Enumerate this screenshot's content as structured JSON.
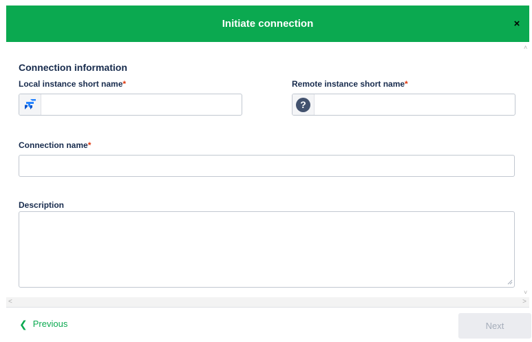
{
  "dialog": {
    "title": "Initiate connection",
    "close_label": "×",
    "accent_color": "#0ba950"
  },
  "form": {
    "section_title": "Connection information",
    "required_marker": "*",
    "local_instance": {
      "label": "Local instance short name",
      "value": "",
      "icon": "jira-logo-icon"
    },
    "remote_instance": {
      "label": "Remote instance short name",
      "value": "",
      "icon": "question-mark-icon",
      "icon_glyph": "?"
    },
    "connection_name": {
      "label": "Connection name",
      "value": ""
    },
    "description": {
      "label": "Description",
      "value": ""
    }
  },
  "footer": {
    "previous_label": "Previous",
    "previous_icon": "chevron-left-icon",
    "previous_glyph": "❮",
    "next_label": "Next",
    "next_disabled": true
  }
}
